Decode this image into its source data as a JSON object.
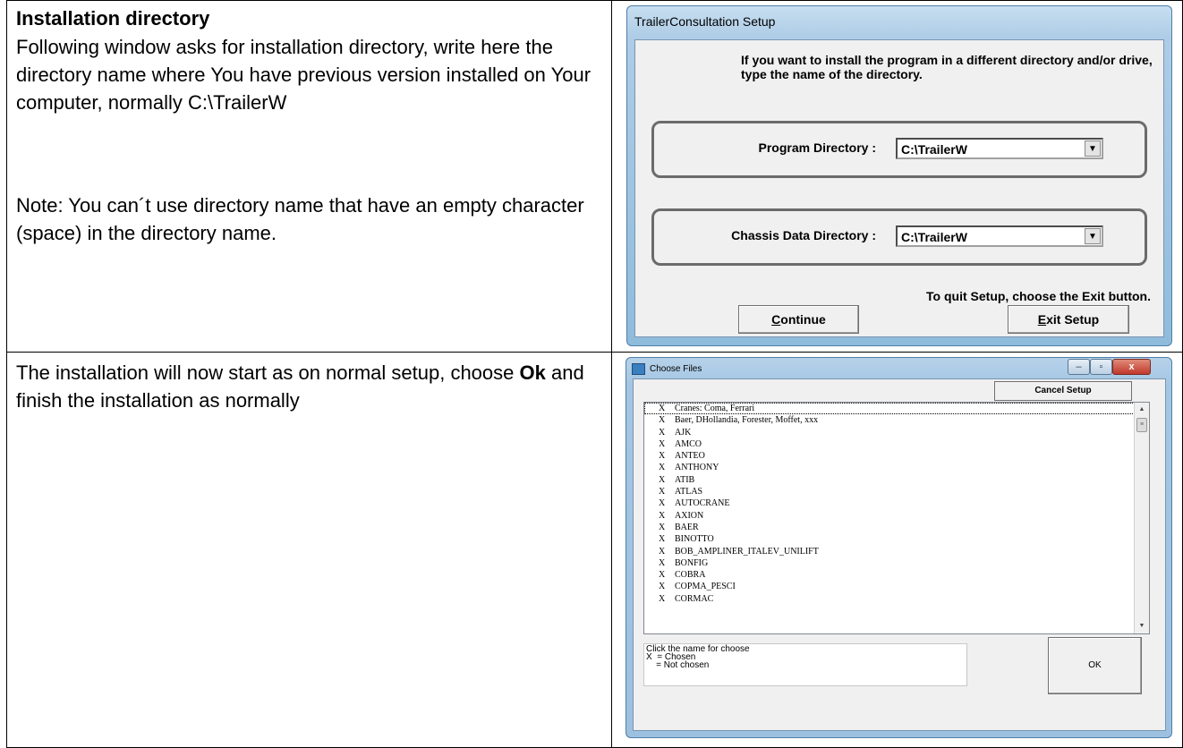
{
  "doc": {
    "heading": "Installation directory",
    "para1": "Following window asks for installation directory, write here the directory name where You have previous version installed on Your computer, normally C:\\TrailerW",
    "para2": "Note: You can´t use directory name that have an empty character (space) in the directory name.",
    "para3_before": "The installation will now start as on normal setup, choose ",
    "para3_bold": "Ok",
    "para3_after": " and finish the installation as normally"
  },
  "setup_window": {
    "title": "TrailerConsultation  Setup",
    "intro": "If you want to install the program in a different directory and/or drive, type the name of the directory.",
    "program_dir_label": "Program Directory :",
    "program_dir_value": "C:\\TrailerW",
    "chassis_dir_label": "Chassis Data Directory :",
    "chassis_dir_value": "C:\\TrailerW",
    "quit_text": "To quit Setup, choose the Exit button.",
    "continue_first": "C",
    "continue_rest": "ontinue",
    "exit_first": "E",
    "exit_rest": "xit Setup"
  },
  "choose_window": {
    "title": "Choose Files",
    "cancel_label": "Cancel Setup",
    "files": [
      {
        "mark": "X",
        "name": "Cranes: Coma, Ferrari"
      },
      {
        "mark": "X",
        "name": "Baer, DHollandia, Forester, Moffet, xxx"
      },
      {
        "mark": "X",
        "name": "AJK"
      },
      {
        "mark": "X",
        "name": "AMCO"
      },
      {
        "mark": "X",
        "name": "ANTEO"
      },
      {
        "mark": "X",
        "name": "ANTHONY"
      },
      {
        "mark": "X",
        "name": "ATIB"
      },
      {
        "mark": "X",
        "name": "ATLAS"
      },
      {
        "mark": "X",
        "name": "AUTOCRANE"
      },
      {
        "mark": "X",
        "name": "AXION"
      },
      {
        "mark": "X",
        "name": "BAER"
      },
      {
        "mark": "X",
        "name": "BINOTTO"
      },
      {
        "mark": "X",
        "name": "BOB_AMPLINER_ITALEV_UNILIFT"
      },
      {
        "mark": "X",
        "name": "BONFIG"
      },
      {
        "mark": "X",
        "name": "COBRA"
      },
      {
        "mark": "X",
        "name": "COPMA_PESCI"
      },
      {
        "mark": "X",
        "name": "CORMAC"
      }
    ],
    "legend_line1": "Click the name for choose",
    "legend_line2": "X  = Chosen",
    "legend_line3": "    = Not chosen",
    "ok_label": "OK"
  }
}
